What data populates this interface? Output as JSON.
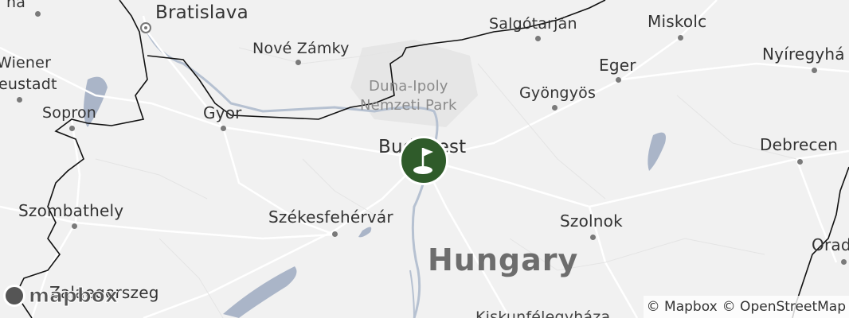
{
  "map": {
    "labels": {
      "bratislava": "Bratislava",
      "nove_zamky": "Nové Zámky",
      "salgotarjan": "Salgótarján",
      "miskolc": "Miskolc",
      "nyiregyhaza": "Nyíregyhá",
      "wiener_neustadt_1": "Wiener",
      "wiener_neustadt_2": "eustadt",
      "sopron": "Sopron",
      "gyor": "Gyor",
      "duna_ipoly_1": "Duna-Ipoly",
      "duna_ipoly_2": "Nemzeti Park",
      "gyongyos": "Gyöngyös",
      "eger": "Eger",
      "budapest": "Budapest",
      "debrecen": "Debrecen",
      "szombathely": "Szombathely",
      "szekesfehervar": "Székesfehérvár",
      "szolnok": "Szolnok",
      "hungary": "Hungary",
      "oradea": "Orad",
      "zalaegerszeg": "Zalaegerszeg",
      "kiskunfelegyhaza": "Kiskunfélegyháza",
      "top_left": "na"
    },
    "marker": {
      "name": "golf course location",
      "icon": "golf-flag-icon",
      "color": "#2f5b2a"
    }
  },
  "logo": {
    "text": "mapbox",
    "icon": "mapbox-logo-icon"
  },
  "attribution": {
    "mapbox": "© Mapbox",
    "osm": "© OpenStreetMap"
  }
}
